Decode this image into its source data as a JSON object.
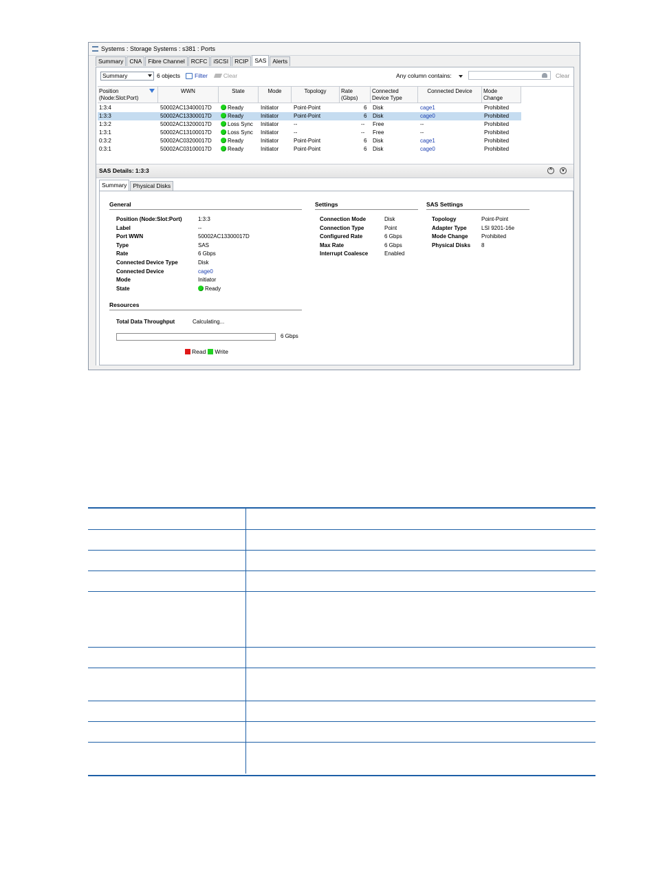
{
  "window": {
    "title": "Systems : Storage Systems : s381 : Ports"
  },
  "tabs": [
    "Summary",
    "CNA",
    "Fibre Channel",
    "RCFC",
    "iSCSI",
    "RCIP",
    "SAS",
    "Alerts"
  ],
  "toolbar": {
    "view_select": "Summary",
    "object_count": "6 objects",
    "filter_label": "Filter",
    "clear_label": "Clear",
    "search_label": "Any column contains:",
    "search_value": "",
    "search_clear_label": "Clear"
  },
  "columns": {
    "position": [
      "Position",
      "(Node:Slot:Port)"
    ],
    "wwn": "WWN",
    "state": "State",
    "mode": "Mode",
    "topology": "Topology",
    "rate": [
      "Rate",
      "(Gbps)"
    ],
    "device_type": [
      "Connected",
      "Device Type"
    ],
    "connected_device": "Connected Device",
    "mode_change": [
      "Mode",
      "Change"
    ]
  },
  "rows": [
    {
      "position": "1:3:4",
      "wwn": "50002AC13400017D",
      "state": "Ready",
      "mode": "Initiator",
      "topology": "Point-Point",
      "rate": "6",
      "device_type": "Disk",
      "device": "cage1",
      "mode_change": "Prohibited"
    },
    {
      "position": "1:3:3",
      "wwn": "50002AC13300017D",
      "state": "Ready",
      "mode": "Initiator",
      "topology": "Point-Point",
      "rate": "6",
      "device_type": "Disk",
      "device": "cage0",
      "mode_change": "Prohibited"
    },
    {
      "position": "1:3:2",
      "wwn": "50002AC13200017D",
      "state": "Loss Sync",
      "mode": "Initiator",
      "topology": "--",
      "rate": "--",
      "device_type": "Free",
      "device": "--",
      "mode_change": "Prohibited"
    },
    {
      "position": "1:3:1",
      "wwn": "50002AC13100017D",
      "state": "Loss Sync",
      "mode": "Initiator",
      "topology": "--",
      "rate": "--",
      "device_type": "Free",
      "device": "--",
      "mode_change": "Prohibited"
    },
    {
      "position": "0:3:2",
      "wwn": "50002AC03200017D",
      "state": "Ready",
      "mode": "Initiator",
      "topology": "Point-Point",
      "rate": "6",
      "device_type": "Disk",
      "device": "cage1",
      "mode_change": "Prohibited"
    },
    {
      "position": "0:3:1",
      "wwn": "50002AC03100017D",
      "state": "Ready",
      "mode": "Initiator",
      "topology": "Point-Point",
      "rate": "6",
      "device_type": "Disk",
      "device": "cage0",
      "mode_change": "Prohibited"
    }
  ],
  "details": {
    "title": "SAS Details: 1:3:3",
    "tabs": [
      "Summary",
      "Physical Disks"
    ],
    "general": {
      "title": "General",
      "position_k": "Position (Node:Slot:Port)",
      "position_v": "1:3:3",
      "label_k": "Label",
      "label_v": "--",
      "wwn_k": "Port WWN",
      "wwn_v": "50002AC13300017D",
      "type_k": "Type",
      "type_v": "SAS",
      "rate_k": "Rate",
      "rate_v": "6 Gbps",
      "cdt_k": "Connected Device Type",
      "cdt_v": "Disk",
      "cd_k": "Connected Device",
      "cd_v": "cage0",
      "mode_k": "Mode",
      "mode_v": "Initiator",
      "state_k": "State",
      "state_v": "Ready"
    },
    "settings": {
      "title": "Settings",
      "cm_k": "Connection Mode",
      "cm_v": "Disk",
      "ct_k": "Connection Type",
      "ct_v": "Point",
      "cr_k": "Configured Rate",
      "cr_v": "6 Gbps",
      "mr_k": "Max Rate",
      "mr_v": "6 Gbps",
      "ic_k": "Interrupt Coalesce",
      "ic_v": "Enabled"
    },
    "sas_settings": {
      "title": "SAS Settings",
      "topo_k": "Topology",
      "topo_v": "Point-Point",
      "adapter_k": "Adapter Type",
      "adapter_v": "LSI 9201-16e",
      "mc_k": "Mode Change",
      "mc_v": "Prohibited",
      "pd_k": "Physical Disks",
      "pd_v": "8"
    },
    "resources": {
      "title": "Resources",
      "throughput_k": "Total Data Throughput",
      "throughput_v": "Calculating...",
      "bar_max": "6 Gbps",
      "read_label": "Read",
      "write_label": "Write"
    }
  },
  "colors": {
    "read": "#e01818",
    "write": "#22d022",
    "table_rule": "#1d5fa6"
  }
}
